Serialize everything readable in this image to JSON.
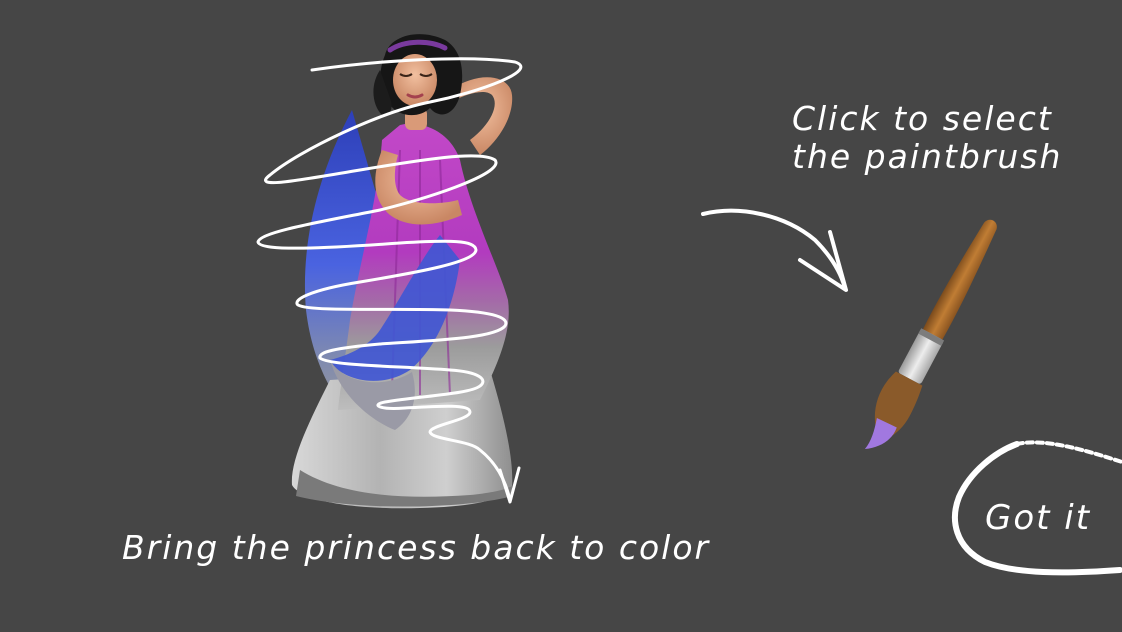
{
  "tutorial": {
    "paintbrush_hint_line1": "Click to select",
    "paintbrush_hint_line2": "the paintbrush",
    "princess_hint": "Bring the princess back to color",
    "got_it_label": "Got it"
  },
  "colors": {
    "background": "#464646",
    "chalk": "#ffffff",
    "dress_color": "#b63bc2",
    "veil_color": "#3f4fd8",
    "brush_handle": "#a8692a",
    "brush_ferrule": "#c8c8c8",
    "brush_tip_paint": "#a178e0"
  },
  "icons": {
    "paintbrush": "paintbrush-icon",
    "princess": "princess-figure",
    "arrow": "chalk-arrow-icon",
    "scribble": "chalk-spiral-scribble"
  }
}
